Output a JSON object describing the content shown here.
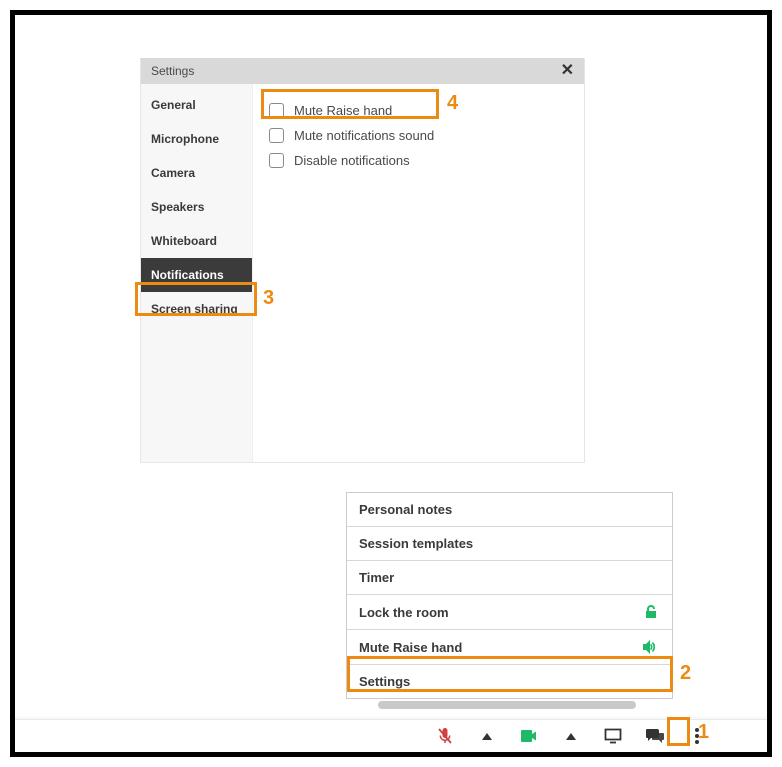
{
  "settings": {
    "title": "Settings",
    "sidebar": [
      {
        "label": "General",
        "active": false
      },
      {
        "label": "Microphone",
        "active": false
      },
      {
        "label": "Camera",
        "active": false
      },
      {
        "label": "Speakers",
        "active": false
      },
      {
        "label": "Whiteboard",
        "active": false
      },
      {
        "label": "Notifications",
        "active": true
      },
      {
        "label": "Screen sharing",
        "active": false
      }
    ],
    "options": [
      {
        "label": "Mute Raise hand",
        "checked": false
      },
      {
        "label": "Mute notifications sound",
        "checked": false
      },
      {
        "label": "Disable notifications",
        "checked": false
      }
    ]
  },
  "menu": [
    {
      "label": "Personal notes",
      "icon": null
    },
    {
      "label": "Session templates",
      "icon": null
    },
    {
      "label": "Timer",
      "icon": null
    },
    {
      "label": "Lock the room",
      "icon": "unlock"
    },
    {
      "label": "Mute Raise hand",
      "icon": "volume"
    },
    {
      "label": "Settings",
      "icon": null
    }
  ],
  "callouts": {
    "1": "1",
    "2": "2",
    "3": "3",
    "4": "4"
  },
  "colors": {
    "accent": "#ec8b14",
    "green": "#1fba67",
    "red": "#d14141"
  }
}
